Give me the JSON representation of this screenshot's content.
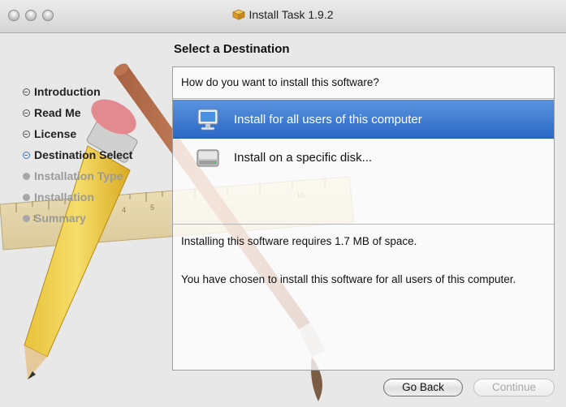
{
  "window": {
    "title": "Install Task 1.9.2",
    "icon": "package-icon"
  },
  "heading": "Select a Destination",
  "steps": [
    {
      "label": "Introduction",
      "state": "done"
    },
    {
      "label": "Read Me",
      "state": "done"
    },
    {
      "label": "License",
      "state": "done"
    },
    {
      "label": "Destination Select",
      "state": "current"
    },
    {
      "label": "Installation Type",
      "state": "future"
    },
    {
      "label": "Installation",
      "state": "future"
    },
    {
      "label": "Summary",
      "state": "future"
    }
  ],
  "panel": {
    "question": "How do you want to install this software?",
    "options": [
      {
        "label": "Install for all users of this computer",
        "icon": "computer-icon",
        "selected": true
      },
      {
        "label": "Install on a specific disk...",
        "icon": "hard-disk-icon",
        "selected": false
      }
    ],
    "space_text": "Installing this software requires 1.7 MB of space.",
    "choice_text": "You have chosen to install this software for all users of this computer."
  },
  "buttons": {
    "back": "Go Back",
    "continue": "Continue",
    "continue_enabled": false
  },
  "colors": {
    "selection": "#3a74d0",
    "window_bg": "#e8e8e8"
  }
}
